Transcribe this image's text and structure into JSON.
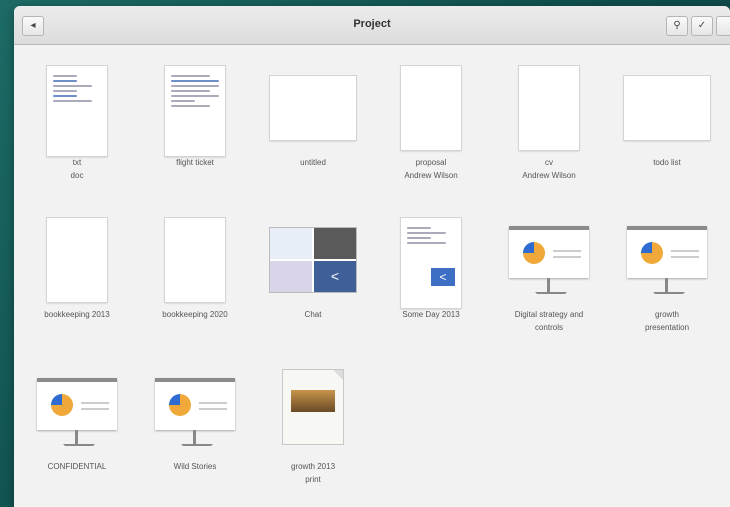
{
  "window": {
    "title": "Project"
  },
  "toolbar": {
    "back_icon": "back-arrow-icon",
    "search_icon": "search-icon",
    "select_icon": "checkmark-icon"
  },
  "items": [
    {
      "label": "txt",
      "label2": "doc"
    },
    {
      "label": "flight ticket",
      "label2": ""
    },
    {
      "label": "untitled",
      "label2": ""
    },
    {
      "label": "proposal",
      "label2": "Andrew Wilson"
    },
    {
      "label": "cv",
      "label2": "Andrew Wilson"
    },
    {
      "label": "todo list",
      "label2": ""
    },
    {
      "label": "bookkeeping 2013",
      "label2": ""
    },
    {
      "label": "bookkeeping 2020",
      "label2": ""
    },
    {
      "label": "Chat",
      "label2": ""
    },
    {
      "label": "Some Day 2013",
      "label2": ""
    },
    {
      "label": "Digital strategy and",
      "label2": "controls"
    },
    {
      "label": "growth",
      "label2": "presentation"
    },
    {
      "label": "CONFIDENTIAL",
      "label2": ""
    },
    {
      "label": "Wild Stories",
      "label2": ""
    },
    {
      "label": "growth 2013",
      "label2": "print"
    }
  ]
}
